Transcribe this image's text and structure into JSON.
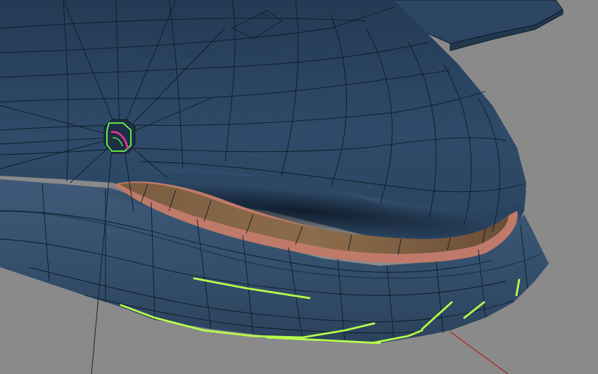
{
  "viewport": {
    "label": "",
    "colors": {
      "background": "#8a8a8a",
      "body": "#2e4a68",
      "body_light": "#46627f",
      "body_dark": "#1d3147",
      "wireframe": "#0e1a26",
      "lip_edge": "#c07a6a",
      "mouth_inner": "#8a6a48",
      "selection": "#b6ff4a",
      "eye_selection": "#6dff44",
      "eye_highlight": "#ff2fa6",
      "axis": "#b02020"
    }
  }
}
